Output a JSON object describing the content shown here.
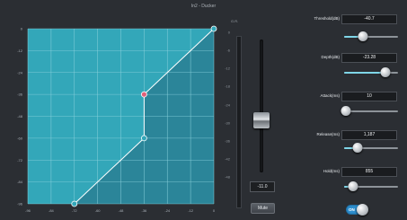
{
  "window": {
    "title": "In2 - Ducker"
  },
  "graph": {
    "y_ticks": [
      "0",
      "-12",
      "-24",
      "-36",
      "-48",
      "-60",
      "-72",
      "-84",
      "-96"
    ],
    "x_ticks": [
      "-96",
      "-84",
      "-72",
      "-60",
      "-48",
      "-36",
      "-24",
      "-12",
      "0"
    ],
    "curve_points_db": [
      [
        -72,
        -96
      ],
      [
        -36,
        -60
      ],
      [
        -36,
        -36
      ],
      [
        0,
        0
      ]
    ],
    "colors": {
      "background": "#33a7b9",
      "fill": "#2a7f93",
      "grid": "#8fd3df",
      "curve": "#ffffff",
      "threshold_node": "#e0607a"
    }
  },
  "gain_reduction": {
    "label": "G.R.",
    "scale": [
      "0",
      "-6",
      "-12",
      "-18",
      "-24",
      "-30",
      "-36",
      "-42",
      "-48"
    ]
  },
  "fader": {
    "value": "-11.0",
    "level_db": -11.0
  },
  "mute": {
    "label": "Mute"
  },
  "params": [
    {
      "label": "Threshold(dB)",
      "value": "-40.7",
      "level": 0.35
    },
    {
      "label": "Depth(dB)",
      "value": "-23.28",
      "level": 0.77
    },
    {
      "label": "Attack(ms)",
      "value": "10",
      "level": 0.03
    },
    {
      "label": "Release(ms)",
      "value": "1,187",
      "level": 0.25
    },
    {
      "label": "Hold(ms)",
      "value": "855",
      "level": 0.17
    }
  ],
  "toggle": {
    "label": "ON",
    "state": true,
    "color": "#2e8fcf"
  }
}
